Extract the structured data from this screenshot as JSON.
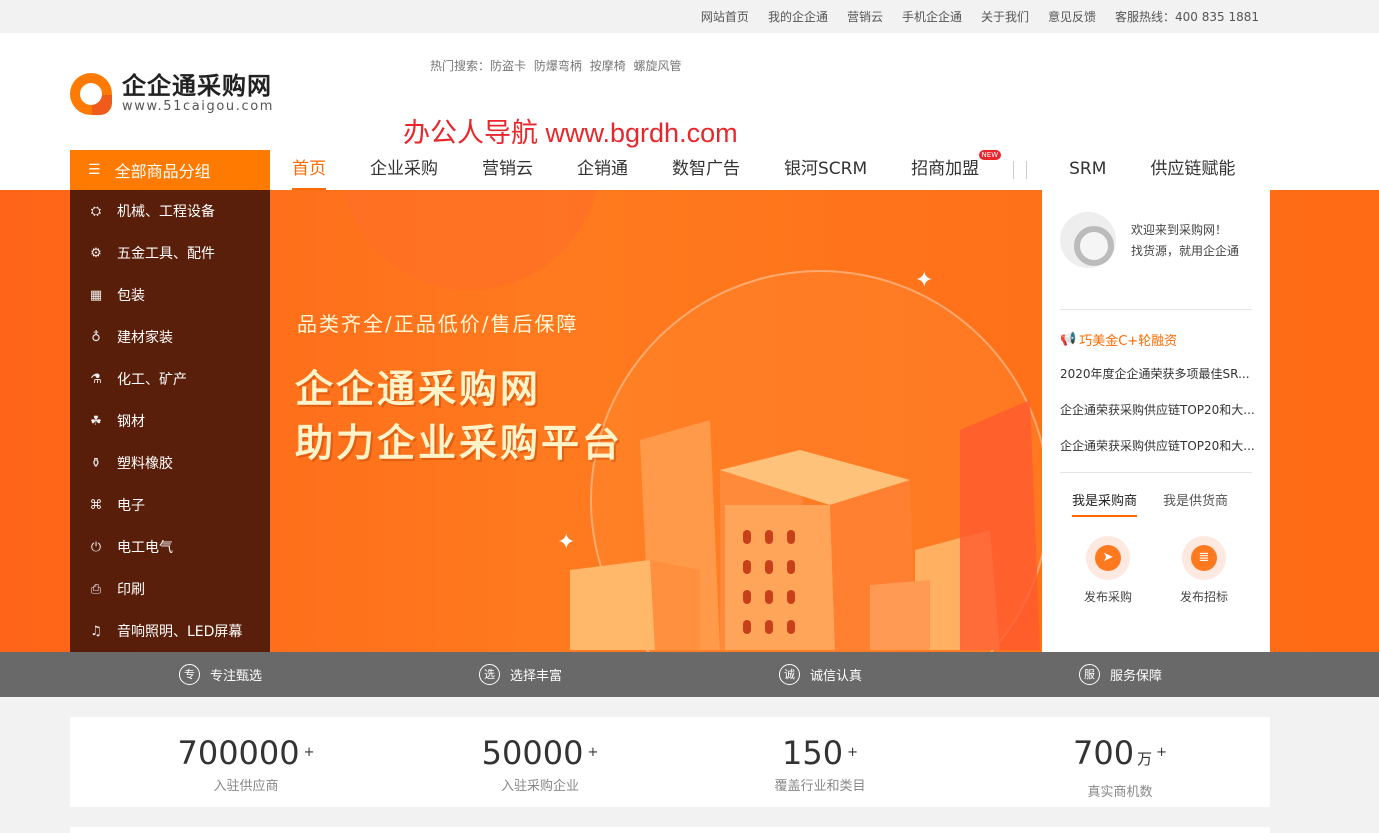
{
  "topbar": {
    "links": [
      "网站首页",
      "我的企企通",
      "营销云",
      "手机企企通",
      "关于我们",
      "意见反馈",
      "客服热线：400 835 1881"
    ]
  },
  "logo": {
    "cn": "企企通采购网",
    "en": "www.51caigou.com"
  },
  "hot_search": {
    "label": "热门搜索：",
    "terms": [
      "防盗卡",
      "防爆弯柄",
      "按摩椅",
      "螺旋风管"
    ]
  },
  "promo": "办公人导航 www.bgrdh.com",
  "category_header": "全部商品分组",
  "nav": {
    "items": [
      "首页",
      "企业采购",
      "营销云",
      "企销通",
      "数智广告",
      "银河SCRM",
      "招商加盟",
      "SRM",
      "供应链赋能"
    ],
    "badge": "NEW"
  },
  "categories": [
    {
      "label": "机械、工程设备",
      "icon": "machine-icon"
    },
    {
      "label": "五金工具、配件",
      "icon": "tools-icon"
    },
    {
      "label": "包装",
      "icon": "package-icon"
    },
    {
      "label": "建材家装",
      "icon": "lamp-icon"
    },
    {
      "label": "化工、矿产",
      "icon": "flask-icon"
    },
    {
      "label": "钢材",
      "icon": "steel-icon"
    },
    {
      "label": "塑料橡胶",
      "icon": "plastic-icon"
    },
    {
      "label": "电子",
      "icon": "chip-icon"
    },
    {
      "label": "电工电气",
      "icon": "plug-icon"
    },
    {
      "label": "印刷",
      "icon": "printer-icon"
    },
    {
      "label": "音响照明、LED屏幕",
      "icon": "speaker-icon"
    }
  ],
  "banner": {
    "slogan": "品类齐全/正品低价/售后保障",
    "line1": "企企通采购网",
    "line2": "助力企业采购平台"
  },
  "sidebar": {
    "welcome1": "欢迎来到采购网！",
    "welcome2": "找货源，就用企企通",
    "news_title": "巧美金C+轮融资",
    "news": [
      "2020年度企企通荣获多项最佳SR...",
      "企企通荣获采购供应链TOP20和大...",
      "企企通荣获采购供应链TOP20和大..."
    ],
    "tabs": [
      "我是采购商",
      "我是供货商"
    ],
    "actions": [
      "发布采购",
      "发布招标"
    ]
  },
  "features": [
    {
      "glyph": "专",
      "label": "专注甄选"
    },
    {
      "glyph": "选",
      "label": "选择丰富"
    },
    {
      "glyph": "诚",
      "label": "诚信认真"
    },
    {
      "glyph": "服",
      "label": "服务保障"
    }
  ],
  "stats": [
    {
      "value": "700000",
      "unit": "",
      "plus": "+",
      "label": "入驻供应商"
    },
    {
      "value": "50000",
      "unit": "",
      "plus": "+",
      "label": "入驻采购企业"
    },
    {
      "value": "150",
      "unit": "",
      "plus": "+",
      "label": "覆盖行业和类目"
    },
    {
      "value": "700",
      "unit": "万",
      "plus": "+",
      "label": "真实商机数"
    }
  ],
  "colors": {
    "accent": "#ff6a00",
    "promo": "#e8272c",
    "feature_bar": "#696969"
  }
}
